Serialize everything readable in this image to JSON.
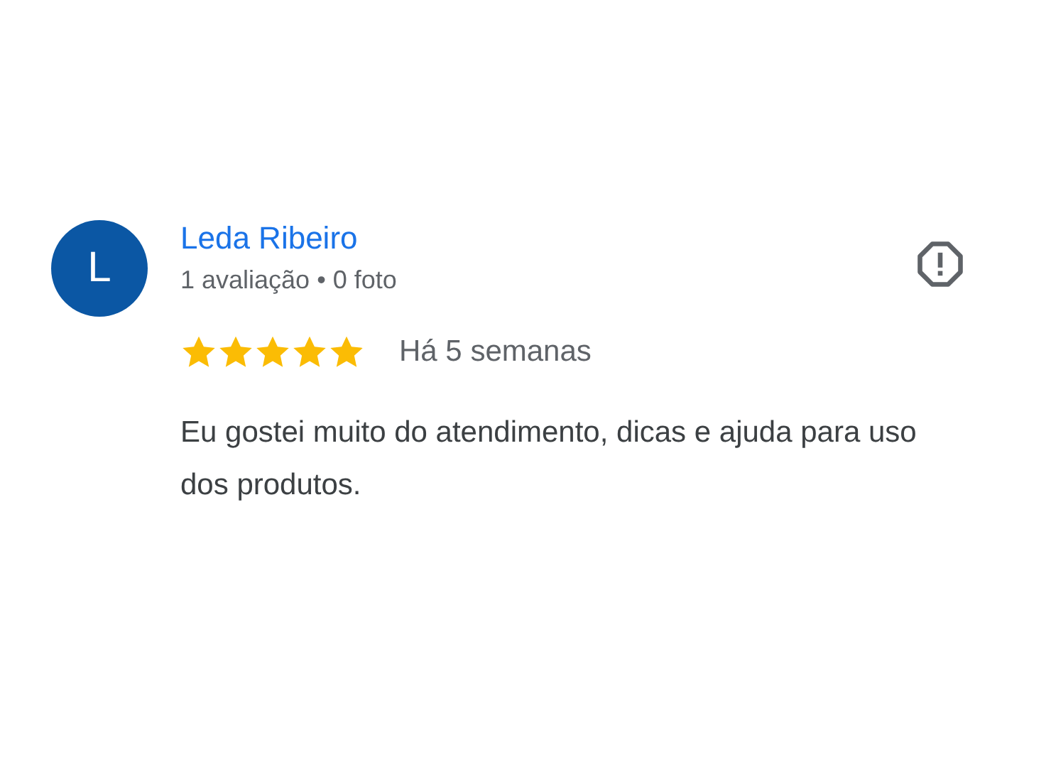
{
  "review": {
    "avatar_letter": "L",
    "author": "Leda Ribeiro",
    "meta": "1 avaliação • 0 foto",
    "stars": 5,
    "time": "Há 5 semanas",
    "text": "Eu gostei muito do atendimento, dicas e ajuda para uso dos produtos."
  }
}
